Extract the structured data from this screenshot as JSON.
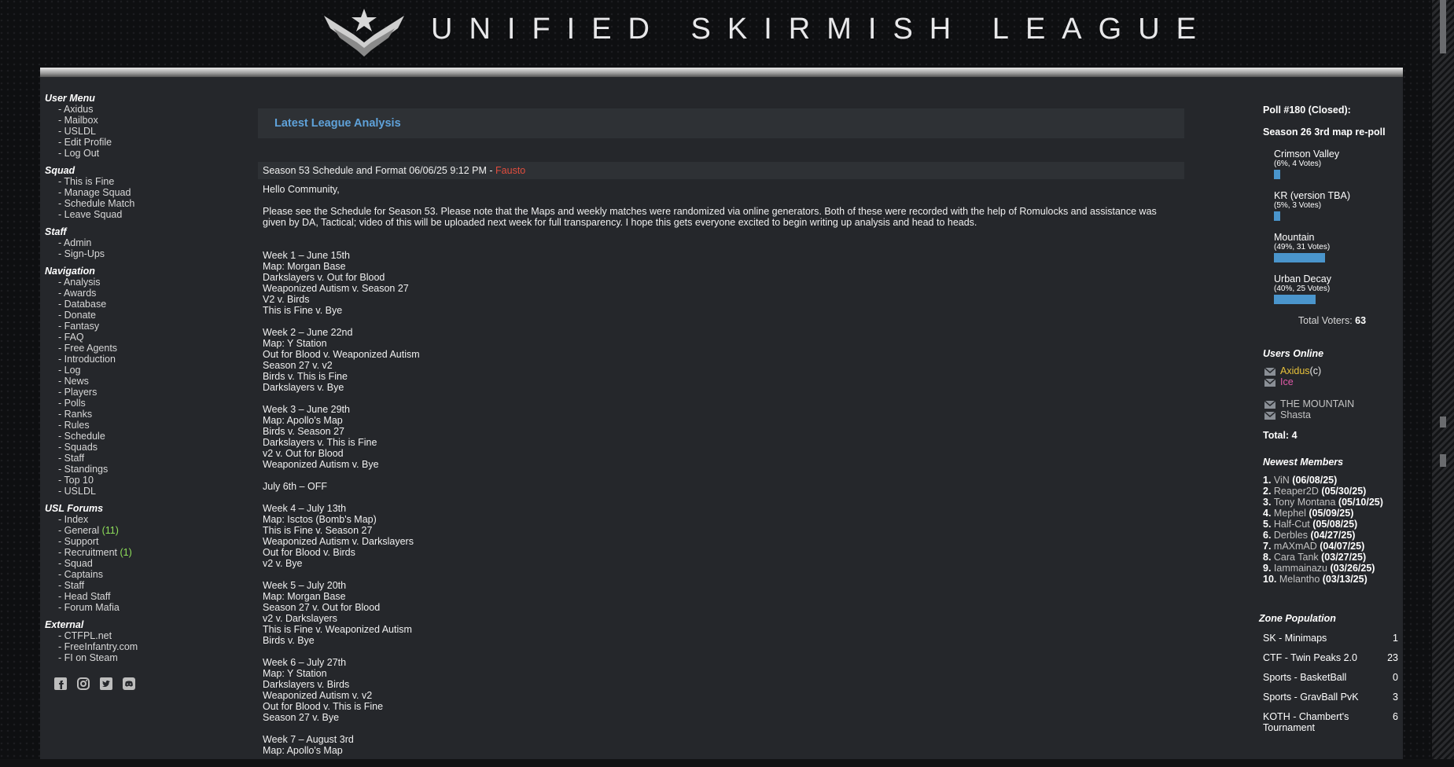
{
  "site": {
    "title": "UNIFIED SKIRMISH LEAGUE"
  },
  "left_menu": [
    {
      "title": "User Menu",
      "items": [
        {
          "label": "Axidus"
        },
        {
          "label": "Mailbox"
        },
        {
          "label": "USLDL"
        },
        {
          "label": "Edit Profile"
        },
        {
          "label": "Log Out"
        }
      ]
    },
    {
      "title": "Squad",
      "items": [
        {
          "label": "This is Fine"
        },
        {
          "label": "Manage Squad"
        },
        {
          "label": "Schedule Match"
        },
        {
          "label": "Leave Squad"
        }
      ]
    },
    {
      "title": "Staff",
      "items": [
        {
          "label": "Admin"
        },
        {
          "label": "Sign-Ups"
        }
      ]
    },
    {
      "title": "Navigation",
      "items": [
        {
          "label": "Analysis"
        },
        {
          "label": "Awards"
        },
        {
          "label": "Database"
        },
        {
          "label": "Donate"
        },
        {
          "label": "Fantasy"
        },
        {
          "label": "FAQ"
        },
        {
          "label": "Free Agents"
        },
        {
          "label": "Introduction"
        },
        {
          "label": "Log"
        },
        {
          "label": "News"
        },
        {
          "label": "Players"
        },
        {
          "label": "Polls"
        },
        {
          "label": "Ranks"
        },
        {
          "label": "Rules"
        },
        {
          "label": "Schedule"
        },
        {
          "label": "Squads"
        },
        {
          "label": "Staff"
        },
        {
          "label": "Standings"
        },
        {
          "label": "Top 10"
        },
        {
          "label": "USLDL"
        }
      ]
    },
    {
      "title": "USL Forums",
      "items": [
        {
          "label": "Index"
        },
        {
          "label": "General",
          "count": "(11)"
        },
        {
          "label": "Support"
        },
        {
          "label": "Recruitment",
          "count": "(1)"
        },
        {
          "label": "Squad"
        },
        {
          "label": "Captains"
        },
        {
          "label": "Staff"
        },
        {
          "label": "Head Staff"
        },
        {
          "label": "Forum Mafia"
        }
      ]
    },
    {
      "title": "External",
      "items": [
        {
          "label": "CTFPL.net"
        },
        {
          "label": "FreeInfantry.com"
        },
        {
          "label": "FI on Steam"
        }
      ]
    }
  ],
  "social": [
    {
      "icon": "facebook-icon"
    },
    {
      "icon": "instagram-icon"
    },
    {
      "icon": "twitter-icon"
    },
    {
      "icon": "discord-icon"
    }
  ],
  "main": {
    "header": "Latest League Analysis",
    "post": {
      "title": "Season 53 Schedule and Format 06/06/25 9:12 PM - ",
      "author": "Fausto",
      "greeting": "Hello Community,",
      "intro": "Please see the Schedule for Season 53. Please note that the Maps and weekly matches were randomized via online generators. Both of these were recorded with the help of Romulocks and assistance was given by DA, Tactical; video of this will be uploaded next week for full transparency. I hope this gets everyone excited to begin writing up analysis and head to heads.",
      "weeks": [
        [
          "Week 1 – June 15th",
          "Map: Morgan Base",
          "Darkslayers v. Out for Blood",
          "Weaponized Autism v. Season 27",
          "V2 v. Birds",
          "This is Fine v. Bye"
        ],
        [
          "Week 2 – June 22nd",
          "Map: Y Station",
          "Out for Blood v. Weaponized Autism",
          "Season 27 v. v2",
          "Birds v. This is Fine",
          "Darkslayers v. Bye"
        ],
        [
          "Week 3 – June 29th",
          "Map: Apollo's Map",
          "Birds v. Season 27",
          "Darkslayers v. This is Fine",
          "v2 v. Out for Blood",
          "Weaponized Autism v. Bye"
        ],
        [
          "July 6th – OFF"
        ],
        [
          "Week 4 – July 13th",
          "Map: Isctos (Bomb's Map)",
          "This is Fine v. Season 27",
          "Weaponized Autism v. Darkslayers",
          "Out for Blood v. Birds",
          "v2 v. Bye"
        ],
        [
          "Week 5 – July 20th",
          "Map: Morgan Base",
          "Season 27 v. Out for Blood",
          "v2 v. Darkslayers",
          "This is Fine v. Weaponized Autism",
          "Birds v. Bye"
        ],
        [
          "Week 6 – July 27th",
          "Map: Y Station",
          "Darkslayers v. Birds",
          "Weaponized Autism v. v2",
          "Out for Blood v. This is Fine",
          "Season 27 v. Bye"
        ],
        [
          "Week 7 – August 3rd",
          "Map: Apollo's Map"
        ]
      ]
    }
  },
  "poll": {
    "title": "Poll #180 (Closed):",
    "question": "Season 26 3rd map re-poll",
    "options": [
      {
        "name": "Crimson Valley",
        "stats": "(6%, 4 Votes)",
        "pct": 0.06
      },
      {
        "name": "KR (version TBA)",
        "stats": "(5%, 3 Votes)",
        "pct": 0.05
      },
      {
        "name": "Mountain",
        "stats": "(49%, 31 Votes)",
        "pct": 0.49
      },
      {
        "name": "Urban Decay",
        "stats": "(40%, 25 Votes)",
        "pct": 0.4
      }
    ],
    "total_label": "Total Voters: ",
    "total": "63"
  },
  "users_online": {
    "title": "Users Online",
    "users": [
      {
        "name": "Axidus",
        "suffix": " (c)",
        "color": "#e8c23a"
      },
      {
        "name": "Ice",
        "suffix": "",
        "color": "#e05aa8"
      },
      {
        "name": "THE MOUNTAIN",
        "suffix": "",
        "color": "#c3c3c3"
      },
      {
        "name": "Shasta",
        "suffix": "",
        "color": "#c3c3c3"
      }
    ],
    "total": "Total: 4"
  },
  "newest_members": {
    "title": "Newest Members",
    "members": [
      {
        "n": "1.",
        "name": "ViN",
        "date": "(06/08/25)"
      },
      {
        "n": "2.",
        "name": "Reaper2D",
        "date": "(05/30/25)"
      },
      {
        "n": "3.",
        "name": "Tony Montana",
        "date": "(05/10/25)"
      },
      {
        "n": "4.",
        "name": "Mephel",
        "date": "(05/09/25)"
      },
      {
        "n": "5.",
        "name": "Half-Cut",
        "date": "(05/08/25)"
      },
      {
        "n": "6.",
        "name": "Derbles",
        "date": "(04/27/25)"
      },
      {
        "n": "7.",
        "name": "mAXmAD",
        "date": "(04/07/25)"
      },
      {
        "n": "8.",
        "name": "Cara Tank",
        "date": "(03/27/25)"
      },
      {
        "n": "9.",
        "name": "Iammainazu",
        "date": "(03/26/25)"
      },
      {
        "n": "10.",
        "name": "Melantho",
        "date": "(03/13/25)"
      }
    ]
  },
  "zones": {
    "title": "Zone Population",
    "list": [
      {
        "name": "SK - Minimaps",
        "count": "1"
      },
      {
        "name": "CTF - Twin Peaks 2.0",
        "count": "23"
      },
      {
        "name": "Sports - BasketBall",
        "count": "0"
      },
      {
        "name": "Sports - GravBall PvK",
        "count": "3"
      },
      {
        "name": "KOTH - Chambert's Tournament",
        "count": "6"
      }
    ]
  },
  "colors": {
    "accent": "#5fa2da",
    "author": "#e04d3e",
    "bar": "#4a95cc",
    "count": "#8fe05b"
  }
}
